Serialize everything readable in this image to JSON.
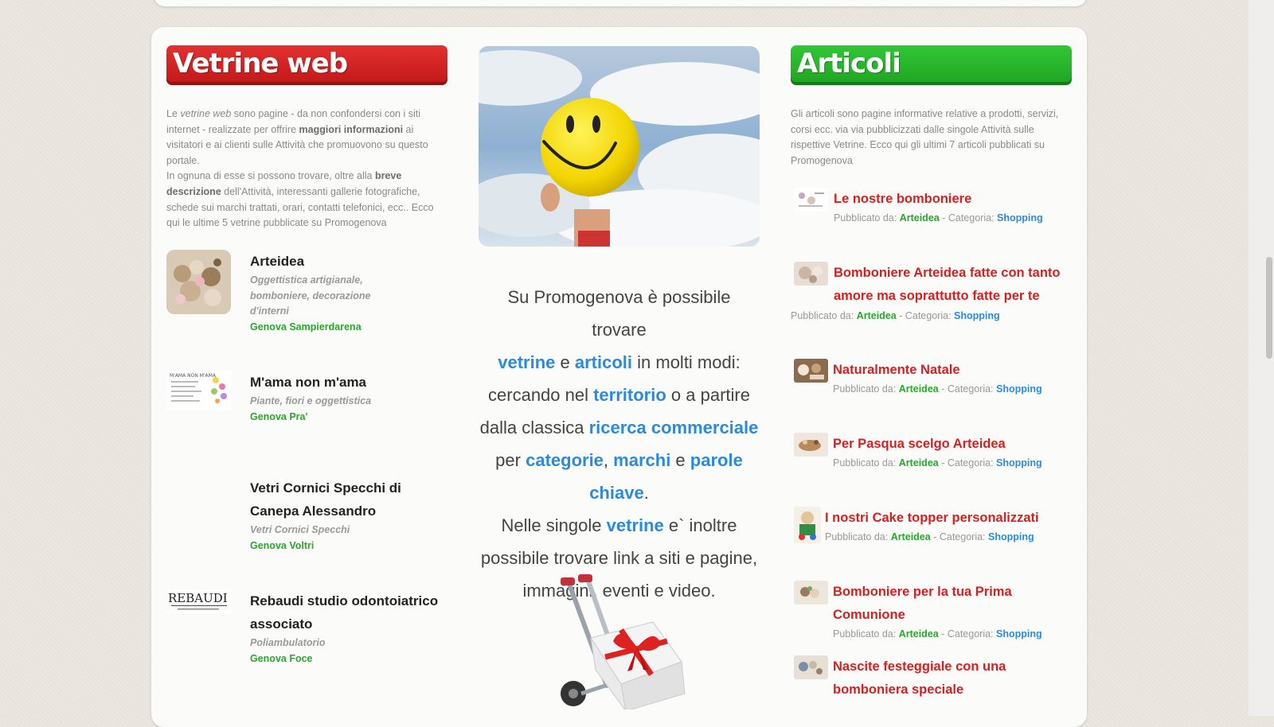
{
  "vetrine": {
    "title": "Vetrine web",
    "intro": {
      "p1": "Le ",
      "p1_em": "vetrine web",
      "p2": " sono pagine - da non confondersi con i siti internet - realizzate per offrire ",
      "p2_b": "maggiori informazioni",
      "p3": " ai visitatori e ai clienti sulle Attività che promuovono su questo portale.",
      "p4": "In ognuna di esse si possono trovare, oltre alla ",
      "p4_b": "breve descrizione",
      "p5": " dell'Attività, interessanti gallerie fotografiche, schede sui marchi trattati, orari, contatti telefonici, ecc.. Ecco qui le ultime 5 vetrine pubblicate su Promogenova"
    },
    "items": [
      {
        "name": "Arteidea",
        "desc": "Oggettistica artigianale, bomboniere, decorazione d'interni",
        "location": "Genova Sampierdarena"
      },
      {
        "name": "M'ama non m'ama",
        "desc": "Piante, fiori e oggettistica",
        "location": "Genova Pra'"
      },
      {
        "name": "Vetri Cornici Specchi di Canepa Alessandro",
        "desc": "Vetri Cornici Specchi",
        "location": "Genova Voltri"
      },
      {
        "name": "Rebaudi studio odontoiatrico associato",
        "desc": "Poliambulatorio",
        "location": "Genova Foce"
      }
    ],
    "logo_rebaudi": "REBAUDI",
    "logo_mama": "M'AMA NON M'AMA"
  },
  "center": {
    "t1": "Su Promogenova è possibile trovare",
    "h1": "vetrine",
    "t2": " e ",
    "h2": "articoli",
    "t3": " in molti modi: cercando nel ",
    "h3": "territorio",
    "t4": " o a partire dalla classica ",
    "h4": "ricerca commerciale",
    "t5": " per ",
    "h5": "categorie",
    "t6": ", ",
    "h6": "marchi",
    "t7": " e ",
    "h7": "parole chiave",
    "t8": ".",
    "t9": "Nelle singole ",
    "h8": "vetrine",
    "t10": " e` inoltre possibile trovare link a siti e pagine, immagini, eventi e video."
  },
  "articoli": {
    "title": "Articoli",
    "intro": "Gli articoli sono pagine informative relative a prodotti, servizi, corsi ecc. via via pubblicizzati dalle singole Attività sulle rispettive Vetrine. Ecco qui gli ultimi 7 articoli pubblicati su Promogenova",
    "published_by": "Pubblicato da: ",
    "category_label": " - Categoria: ",
    "items": [
      {
        "title": "Le nostre bomboniere",
        "author": "Arteidea",
        "category": "Shopping"
      },
      {
        "title": "Bomboniere Arteidea fatte con tanto amore ma soprattutto fatte per te",
        "author": "Arteidea",
        "category": "Shopping"
      },
      {
        "title": "Naturalmente Natale",
        "author": "Arteidea",
        "category": "Shopping"
      },
      {
        "title": "Per Pasqua scelgo Arteidea",
        "author": "Arteidea",
        "category": "Shopping"
      },
      {
        "title": "I nostri Cake topper personalizzati",
        "author": "Arteidea",
        "category": "Shopping"
      },
      {
        "title": "Bomboniere per la tua Prima Comunione",
        "author": "Arteidea",
        "category": "Shopping"
      },
      {
        "title": "Nascite festeggiale con una bomboniera speciale",
        "author": "",
        "category": ""
      }
    ]
  }
}
